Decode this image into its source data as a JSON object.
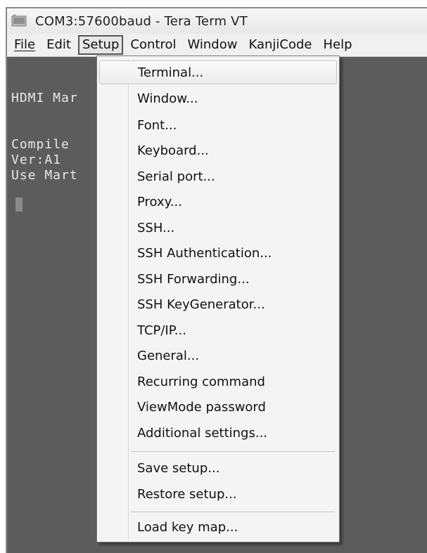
{
  "window": {
    "title": "COM3:57600baud - Tera Term VT"
  },
  "menubar": {
    "items": [
      {
        "label": "File",
        "active": false
      },
      {
        "label": "Edit",
        "active": false
      },
      {
        "label": "Setup",
        "active": true
      },
      {
        "label": "Control",
        "active": false
      },
      {
        "label": "Window",
        "active": false
      },
      {
        "label": "KanjiCode",
        "active": false
      },
      {
        "label": "Help",
        "active": false
      }
    ]
  },
  "terminal": {
    "lines": [
      "HDMI Mar",
      "Compile ",
      "Ver:A1",
      "Use Mart"
    ]
  },
  "setup_menu": {
    "items": [
      {
        "label": "Terminal...",
        "highlighted": true
      },
      {
        "label": "Window..."
      },
      {
        "label": "Font..."
      },
      {
        "label": "Keyboard..."
      },
      {
        "label": "Serial port..."
      },
      {
        "label": "Proxy..."
      },
      {
        "label": "SSH..."
      },
      {
        "label": "SSH Authentication..."
      },
      {
        "label": "SSH Forwarding..."
      },
      {
        "label": "SSH KeyGenerator..."
      },
      {
        "label": "TCP/IP..."
      },
      {
        "label": "General..."
      },
      {
        "label": "Recurring command"
      },
      {
        "label": "ViewMode password"
      },
      {
        "label": "Additional settings..."
      },
      {
        "label": "Save setup..."
      },
      {
        "label": "Restore setup..."
      },
      {
        "label": "Load key map..."
      }
    ]
  },
  "colors": {
    "terminal_bg": "#5c5c5c",
    "menu_bg": "#f4f4f4"
  }
}
